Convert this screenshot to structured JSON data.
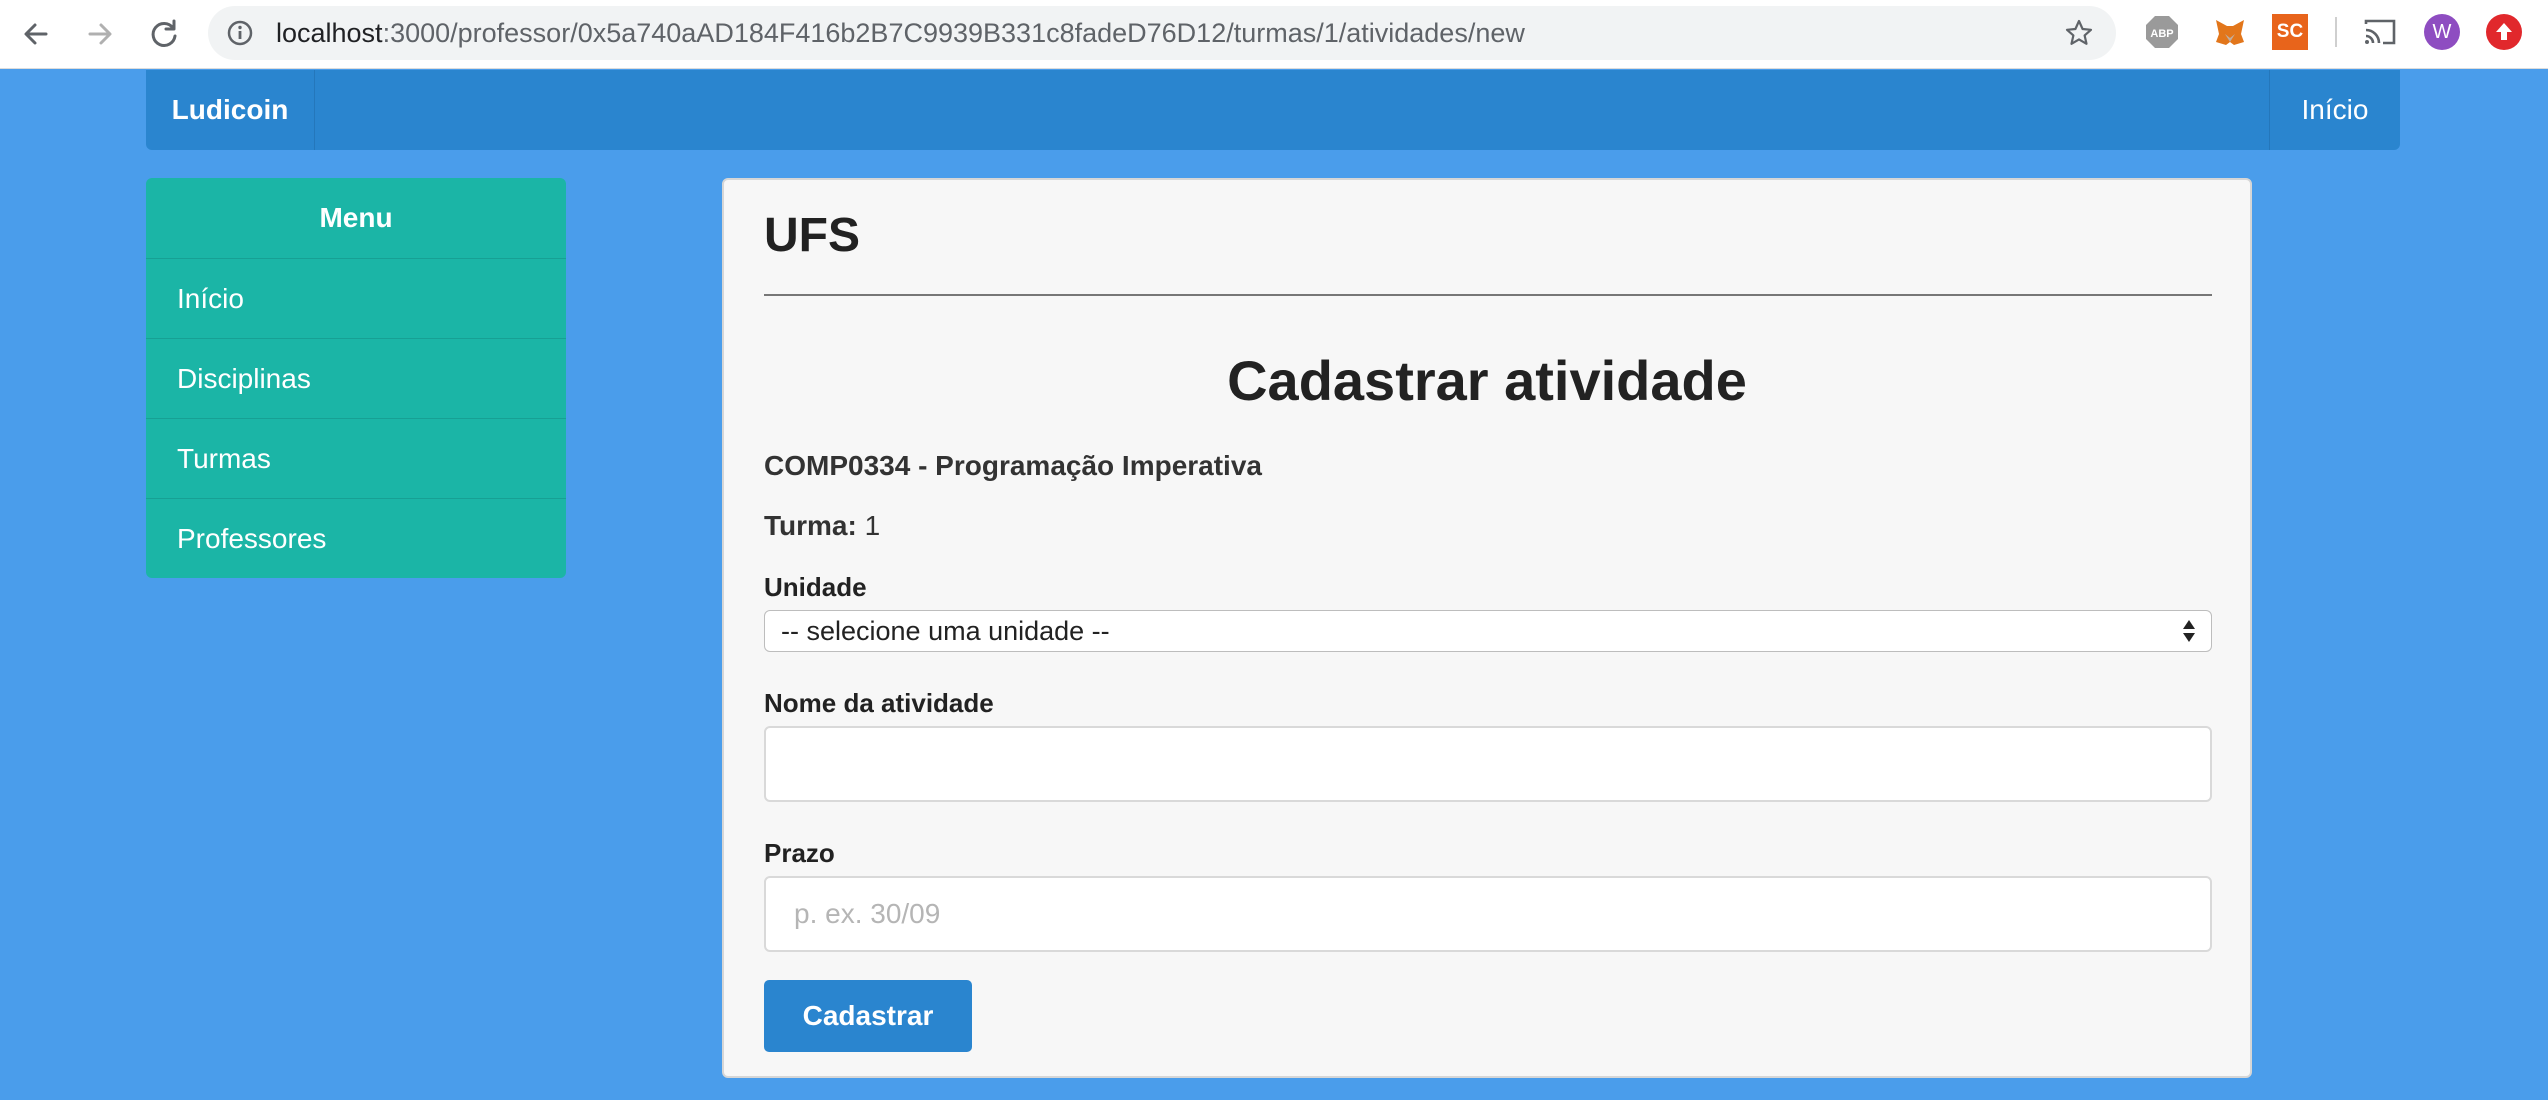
{
  "browser": {
    "url_host": "localhost",
    "url_path": ":3000/professor/0x5a740aAD184F416b2B7C9939B331c8fadeD76D12/turmas/1/atividades/new",
    "extensions": {
      "abp_label": "ABP",
      "sc_label": "SC",
      "avatar_letter": "W"
    },
    "icons": [
      "back-arrow-icon",
      "forward-arrow-icon",
      "reload-icon",
      "info-icon",
      "bookmark-star-icon",
      "cast-icon",
      "update-icon"
    ]
  },
  "navbar": {
    "brand": "Ludicoin",
    "right_link": "Início",
    "color": "#2a85cf"
  },
  "menu": {
    "title": "Menu",
    "items": [
      {
        "label": "Início"
      },
      {
        "label": "Disciplinas"
      },
      {
        "label": "Turmas"
      },
      {
        "label": "Professores"
      }
    ],
    "color": "#1bb5a6"
  },
  "main": {
    "institution": "UFS",
    "form_title": "Cadastrar atividade",
    "course": "COMP0334 - Programação Imperativa",
    "turma_label": "Turma:",
    "turma_value": "1",
    "unidade": {
      "label": "Unidade",
      "selected": "-- selecione uma unidade --"
    },
    "nome": {
      "label": "Nome da atividade",
      "value": "",
      "placeholder": ""
    },
    "prazo": {
      "label": "Prazo",
      "value": "",
      "placeholder": "p. ex. 30/09"
    },
    "submit_label": "Cadastrar"
  },
  "colors": {
    "page_background": "#4a9deb",
    "panel_background": "#f7f7f7"
  }
}
